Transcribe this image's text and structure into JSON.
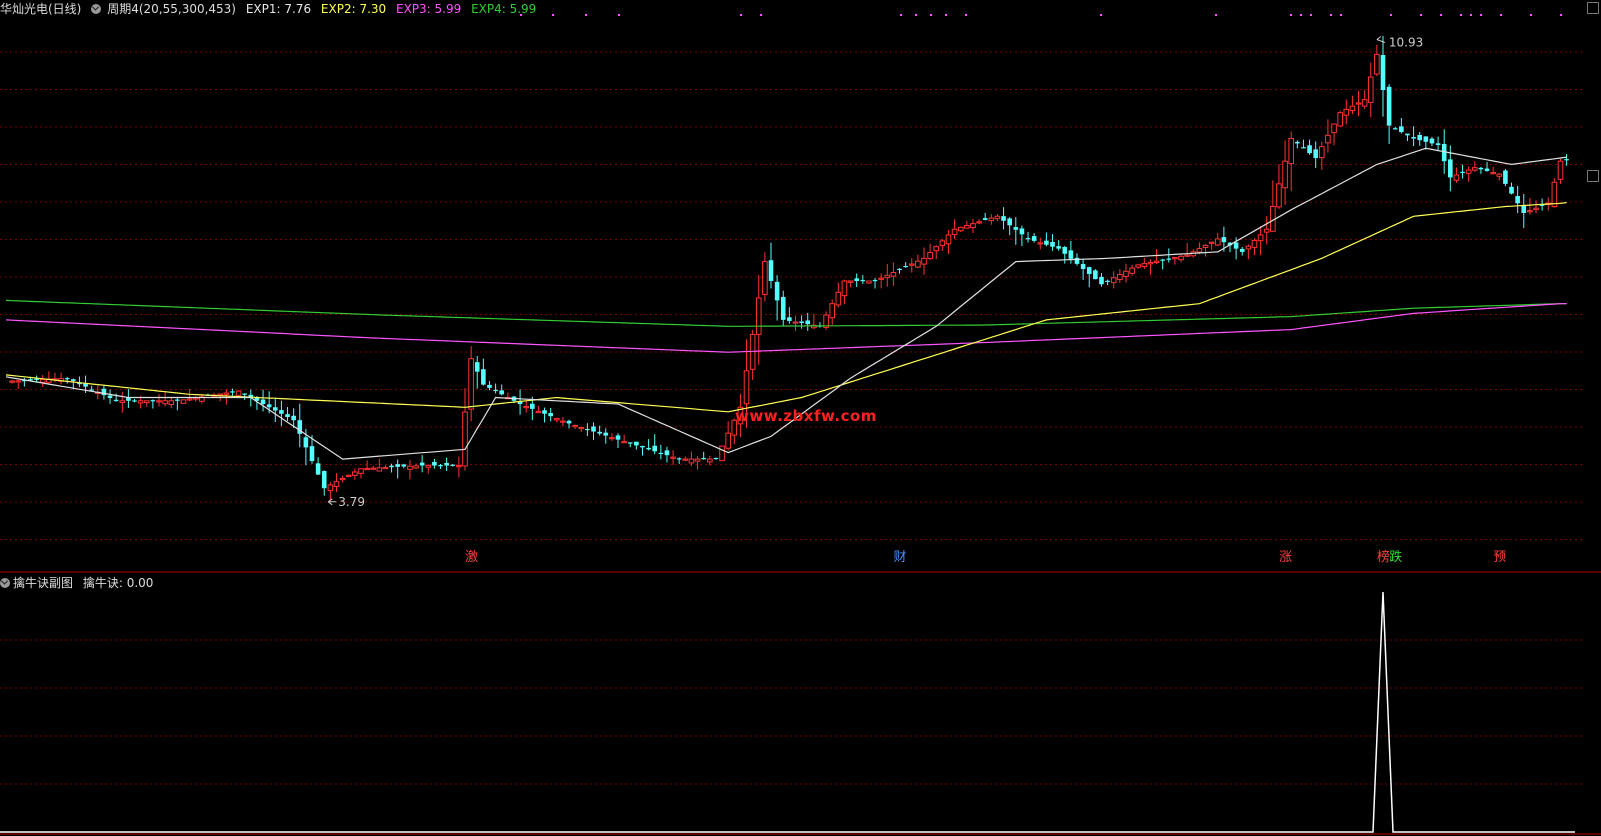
{
  "header": {
    "stock": "华灿光电(日线)",
    "indicator": "周期4(20,55,300,453)",
    "exp1": "EXP1: 7.76",
    "exp2": "EXP2: 7.30",
    "exp3": "EXP3: 5.99",
    "exp4": "EXP4: 5.99"
  },
  "sub_header": {
    "title": "擒牛诀副图",
    "value": "擒牛诀: 0.00"
  },
  "watermark": "www.zbxfw.com",
  "annotations": {
    "high": "10.93",
    "low": "3.79"
  },
  "signals": [
    {
      "label": "激",
      "color": "#ff4040",
      "index": 76
    },
    {
      "label": "财",
      "color": "#4a8cff",
      "index": 146
    },
    {
      "label": "涨",
      "color": "#ff4040",
      "index": 209
    },
    {
      "label": "榜",
      "color": "#ff4040",
      "index": 225
    },
    {
      "label": "跌",
      "color": "#33dd33",
      "index": 227
    },
    {
      "label": "预",
      "color": "#ff4040",
      "index": 244
    }
  ],
  "colors": {
    "up": "#ff3232",
    "down": "#54ffff",
    "exp1": "#e0e0e0",
    "exp2": "#ffff55",
    "exp3": "#ff55ff",
    "exp4": "#33cc33",
    "grid": "#7a0000",
    "sub_line": "#ffffff"
  },
  "chart_data": [
    {
      "type": "candlestick",
      "price_range": [
        3.2,
        11.2
      ],
      "key_points": [
        {
          "i": 0,
          "v": 5.65
        },
        {
          "i": 10,
          "v": 5.7
        },
        {
          "i": 18,
          "v": 5.35
        },
        {
          "i": 28,
          "v": 5.35
        },
        {
          "i": 38,
          "v": 5.5
        },
        {
          "i": 47,
          "v": 5.05
        },
        {
          "i": 52,
          "v": 4.0
        },
        {
          "i": 58,
          "v": 4.3
        },
        {
          "i": 68,
          "v": 4.35
        },
        {
          "i": 74,
          "v": 4.35
        },
        {
          "i": 76,
          "v": 6.0
        },
        {
          "i": 78,
          "v": 5.6
        },
        {
          "i": 84,
          "v": 5.3
        },
        {
          "i": 92,
          "v": 5.0
        },
        {
          "i": 100,
          "v": 4.75
        },
        {
          "i": 110,
          "v": 4.45
        },
        {
          "i": 116,
          "v": 4.45
        },
        {
          "i": 120,
          "v": 5.25
        },
        {
          "i": 124,
          "v": 7.5
        },
        {
          "i": 127,
          "v": 6.6
        },
        {
          "i": 133,
          "v": 6.5
        },
        {
          "i": 137,
          "v": 7.2
        },
        {
          "i": 142,
          "v": 7.2
        },
        {
          "i": 150,
          "v": 7.55
        },
        {
          "i": 155,
          "v": 8.0
        },
        {
          "i": 162,
          "v": 8.2
        },
        {
          "i": 167,
          "v": 7.85
        },
        {
          "i": 172,
          "v": 7.7
        },
        {
          "i": 179,
          "v": 7.15
        },
        {
          "i": 185,
          "v": 7.45
        },
        {
          "i": 193,
          "v": 7.6
        },
        {
          "i": 198,
          "v": 7.85
        },
        {
          "i": 202,
          "v": 7.65
        },
        {
          "i": 206,
          "v": 8.0
        },
        {
          "i": 210,
          "v": 9.4
        },
        {
          "i": 214,
          "v": 9.1
        },
        {
          "i": 218,
          "v": 9.8
        },
        {
          "i": 222,
          "v": 10.0
        },
        {
          "i": 224,
          "v": 10.7
        },
        {
          "i": 226,
          "v": 9.6
        },
        {
          "i": 230,
          "v": 9.4
        },
        {
          "i": 234,
          "v": 9.3
        },
        {
          "i": 236,
          "v": 8.8
        },
        {
          "i": 240,
          "v": 8.95
        },
        {
          "i": 244,
          "v": 8.85
        },
        {
          "i": 248,
          "v": 8.25
        },
        {
          "i": 252,
          "v": 8.4
        },
        {
          "i": 254,
          "v": 9.05
        }
      ],
      "exp1_points": [
        {
          "i": 0,
          "v": 5.72
        },
        {
          "i": 20,
          "v": 5.4
        },
        {
          "i": 40,
          "v": 5.4
        },
        {
          "i": 55,
          "v": 4.45
        },
        {
          "i": 75,
          "v": 4.6
        },
        {
          "i": 80,
          "v": 5.4
        },
        {
          "i": 100,
          "v": 5.3
        },
        {
          "i": 118,
          "v": 4.55
        },
        {
          "i": 125,
          "v": 4.8
        },
        {
          "i": 138,
          "v": 5.7
        },
        {
          "i": 152,
          "v": 6.5
        },
        {
          "i": 165,
          "v": 7.5
        },
        {
          "i": 180,
          "v": 7.55
        },
        {
          "i": 198,
          "v": 7.65
        },
        {
          "i": 210,
          "v": 8.3
        },
        {
          "i": 224,
          "v": 9.0
        },
        {
          "i": 232,
          "v": 9.25
        },
        {
          "i": 246,
          "v": 9.0
        },
        {
          "i": 254,
          "v": 9.1
        }
      ],
      "exp2_points": [
        {
          "i": 0,
          "v": 5.75
        },
        {
          "i": 30,
          "v": 5.45
        },
        {
          "i": 75,
          "v": 5.25
        },
        {
          "i": 90,
          "v": 5.4
        },
        {
          "i": 118,
          "v": 5.18
        },
        {
          "i": 130,
          "v": 5.4
        },
        {
          "i": 150,
          "v": 6.0
        },
        {
          "i": 170,
          "v": 6.6
        },
        {
          "i": 195,
          "v": 6.85
        },
        {
          "i": 215,
          "v": 7.55
        },
        {
          "i": 230,
          "v": 8.2
        },
        {
          "i": 245,
          "v": 8.35
        },
        {
          "i": 254,
          "v": 8.4
        }
      ],
      "exp3_points": [
        {
          "i": 0,
          "v": 6.6
        },
        {
          "i": 60,
          "v": 6.32
        },
        {
          "i": 118,
          "v": 6.1
        },
        {
          "i": 160,
          "v": 6.25
        },
        {
          "i": 210,
          "v": 6.45
        },
        {
          "i": 230,
          "v": 6.7
        },
        {
          "i": 254,
          "v": 6.85
        }
      ],
      "exp4_points": [
        {
          "i": 0,
          "v": 6.9
        },
        {
          "i": 60,
          "v": 6.68
        },
        {
          "i": 118,
          "v": 6.5
        },
        {
          "i": 160,
          "v": 6.52
        },
        {
          "i": 210,
          "v": 6.65
        },
        {
          "i": 230,
          "v": 6.78
        },
        {
          "i": 254,
          "v": 6.85
        }
      ]
    },
    {
      "type": "line",
      "name": "擒牛诀",
      "range": [
        0,
        1
      ],
      "spike_index": 225,
      "spike_value": 1.0
    }
  ]
}
